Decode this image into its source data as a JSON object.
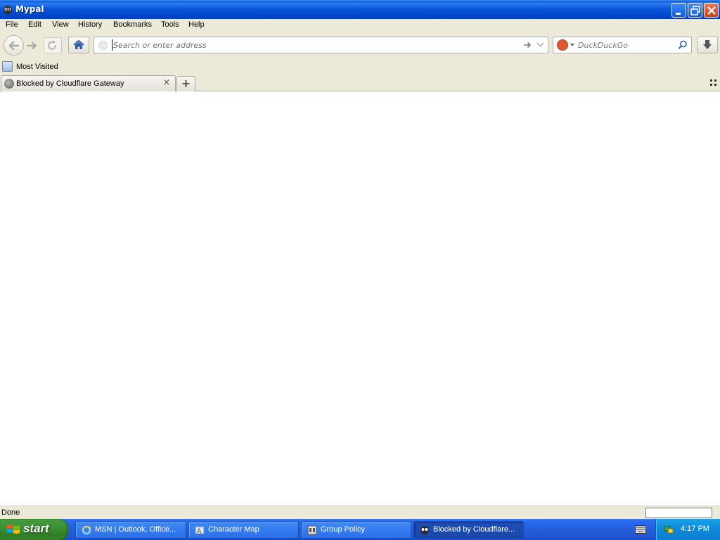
{
  "window": {
    "title": "Mypal",
    "controls": [
      "minimize",
      "restore",
      "close"
    ]
  },
  "menubar": {
    "items": [
      "File",
      "Edit",
      "View",
      "History",
      "Bookmarks",
      "Tools",
      "Help"
    ]
  },
  "navbar": {
    "url_placeholder": "Search or enter address",
    "url_value": "",
    "search_engine": "DuckDuckGo",
    "search_placeholder": "DuckDuckGo"
  },
  "bookmarks": {
    "items": [
      "Most Visited"
    ]
  },
  "tabs": [
    {
      "label": "Blocked by Cloudflare Gateway",
      "active": true
    }
  ],
  "status": {
    "text": "Done"
  },
  "taskbar": {
    "start_label": "start",
    "items": [
      {
        "label": "MSN | Outlook, Office...",
        "icon": "ie-icon",
        "active": false
      },
      {
        "label": "Character Map",
        "icon": "charmap-icon",
        "active": false
      },
      {
        "label": "Group Policy",
        "icon": "group-policy-icon",
        "active": false
      },
      {
        "label": "Blocked by Cloudflare...",
        "icon": "mypal-icon",
        "active": true
      }
    ],
    "clock": "4:17 PM"
  },
  "colors": {
    "titlebar": "#0a56d8",
    "taskbar": "#245edc",
    "start": "#3c9232",
    "tray": "#0f89d9",
    "chrome": "#ece9d8"
  }
}
